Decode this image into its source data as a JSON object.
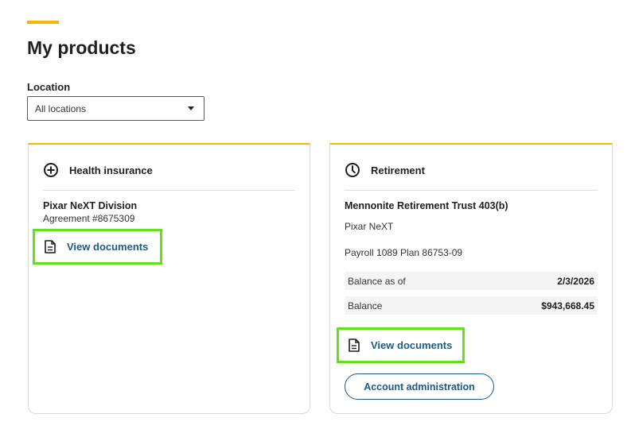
{
  "page": {
    "title": "My products"
  },
  "location": {
    "label": "Location",
    "selected": "All locations"
  },
  "health": {
    "title": "Health insurance",
    "product_name": "Pixar NeXT Division",
    "agreement": "Agreement #8675309",
    "docs_link": "View documents",
    "icon": "circle-plus-icon"
  },
  "retirement": {
    "title": "Retirement",
    "product_name": "Mennonite Retirement Trust 403(b)",
    "employer": "Pixar NeXT",
    "plan": "Payroll 1089 Plan 86753-09",
    "balance_as_of_label": "Balance as of",
    "balance_as_of_value": "2/3/2026",
    "balance_label": "Balance",
    "balance_value": "$943,668.45",
    "docs_link": "View documents",
    "account_admin_button": "Account administration",
    "icon": "clock-icon"
  },
  "colors": {
    "accent": "#f2b707",
    "link": "#1c5a85",
    "highlight": "#63e21a"
  }
}
